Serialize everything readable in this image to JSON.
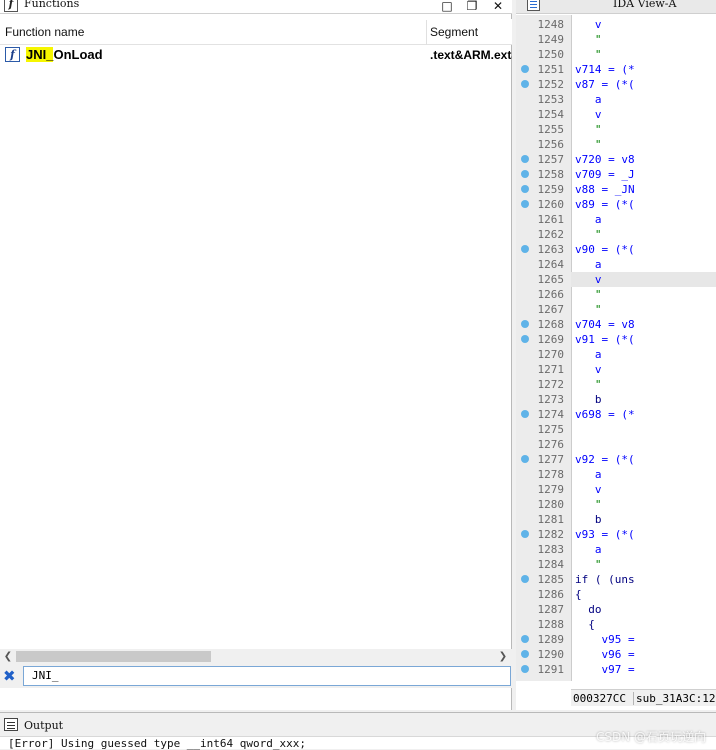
{
  "functions_panel": {
    "title": "Functions",
    "title_icon": "f",
    "columns": {
      "name": "Function name",
      "segment": "Segment"
    },
    "rows": [
      {
        "icon": "f",
        "name_highlight": "JNI_",
        "name_rest": "OnLoad",
        "segment": ".text&ARM.extab"
      }
    ],
    "search_text": "JNI_"
  },
  "ida_view": {
    "tab_title": "IDA View-A",
    "lines": [
      {
        "num": "1248",
        "code": "   v",
        "dot": false,
        "style": ""
      },
      {
        "num": "1249",
        "code": "   \"",
        "dot": false,
        "style": "str"
      },
      {
        "num": "1250",
        "code": "   \"",
        "dot": false,
        "style": "str"
      },
      {
        "num": "1251",
        "code": "v714 = (*",
        "dot": true,
        "style": ""
      },
      {
        "num": "1252",
        "code": "v87 = (*(",
        "dot": true,
        "style": ""
      },
      {
        "num": "1253",
        "code": "   a",
        "dot": false,
        "style": ""
      },
      {
        "num": "1254",
        "code": "   v",
        "dot": false,
        "style": ""
      },
      {
        "num": "1255",
        "code": "   \"",
        "dot": false,
        "style": "str"
      },
      {
        "num": "1256",
        "code": "   \"",
        "dot": false,
        "style": "str"
      },
      {
        "num": "1257",
        "code": "v720 = v8",
        "dot": true,
        "style": ""
      },
      {
        "num": "1258",
        "code": "v709 = _J",
        "dot": true,
        "style": ""
      },
      {
        "num": "1259",
        "code": "v88 = _JN",
        "dot": true,
        "style": ""
      },
      {
        "num": "1260",
        "code": "v89 = (*(",
        "dot": true,
        "style": ""
      },
      {
        "num": "1261",
        "code": "   a",
        "dot": false,
        "style": ""
      },
      {
        "num": "1262",
        "code": "   \"",
        "dot": false,
        "style": "str"
      },
      {
        "num": "1263",
        "code": "v90 = (*(",
        "dot": true,
        "style": ""
      },
      {
        "num": "1264",
        "code": "   a",
        "dot": false,
        "style": ""
      },
      {
        "num": "1265",
        "code": "   v",
        "dot": false,
        "style": "",
        "current": true
      },
      {
        "num": "1266",
        "code": "   \"",
        "dot": false,
        "style": "str"
      },
      {
        "num": "1267",
        "code": "   \"",
        "dot": false,
        "style": "str"
      },
      {
        "num": "1268",
        "code": "v704 = v8",
        "dot": true,
        "style": ""
      },
      {
        "num": "1269",
        "code": "v91 = (*(",
        "dot": true,
        "style": ""
      },
      {
        "num": "1270",
        "code": "   a",
        "dot": false,
        "style": ""
      },
      {
        "num": "1271",
        "code": "   v",
        "dot": false,
        "style": ""
      },
      {
        "num": "1272",
        "code": "   \"",
        "dot": false,
        "style": "str"
      },
      {
        "num": "1273",
        "code": "   b",
        "dot": false,
        "style": "kw"
      },
      {
        "num": "1274",
        "code": "v698 = (*",
        "dot": true,
        "style": ""
      },
      {
        "num": "1275",
        "code": "",
        "dot": false,
        "style": ""
      },
      {
        "num": "1276",
        "code": "",
        "dot": false,
        "style": ""
      },
      {
        "num": "1277",
        "code": "v92 = (*(",
        "dot": true,
        "style": ""
      },
      {
        "num": "1278",
        "code": "   a",
        "dot": false,
        "style": ""
      },
      {
        "num": "1279",
        "code": "   v",
        "dot": false,
        "style": ""
      },
      {
        "num": "1280",
        "code": "   \"",
        "dot": false,
        "style": "str"
      },
      {
        "num": "1281",
        "code": "   b",
        "dot": false,
        "style": "kw"
      },
      {
        "num": "1282",
        "code": "v93 = (*(",
        "dot": true,
        "style": ""
      },
      {
        "num": "1283",
        "code": "   a",
        "dot": false,
        "style": ""
      },
      {
        "num": "1284",
        "code": "   \"",
        "dot": false,
        "style": "str"
      },
      {
        "num": "1285",
        "code": "if ( (uns",
        "dot": true,
        "style": "kw"
      },
      {
        "num": "1286",
        "code": "{",
        "dot": false,
        "style": "kw"
      },
      {
        "num": "1287",
        "code": "  do",
        "dot": false,
        "style": "kw"
      },
      {
        "num": "1288",
        "code": "  {",
        "dot": false,
        "style": "kw"
      },
      {
        "num": "1289",
        "code": "    v95 =",
        "dot": true,
        "style": ""
      },
      {
        "num": "1290",
        "code": "    v96 =",
        "dot": true,
        "style": ""
      },
      {
        "num": "1291",
        "code": "    v97 =",
        "dot": true,
        "style": ""
      }
    ],
    "status_address": "000327CC",
    "status_function": "sub_31A3C:12"
  },
  "output_panel": {
    "title": "Output",
    "visible_line": "[Error] Using guessed type __int64 qword_xxx;"
  },
  "watermark": "CSDN @石页玩逆向",
  "colors": {
    "breakpoint_dot": "#5fb3e8",
    "highlight": "#f6f600",
    "code_blue": "#0000ff",
    "string_green": "#008000"
  }
}
